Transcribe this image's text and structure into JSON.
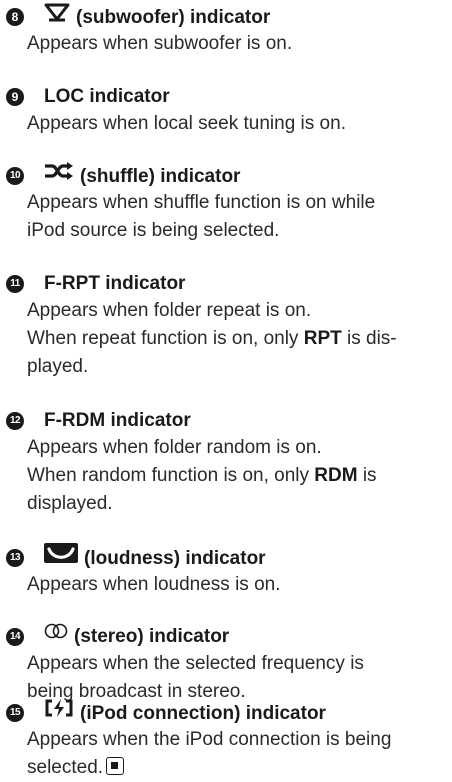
{
  "entries": [
    {
      "number": "8",
      "icon": "subwoofer-icon",
      "title": "(subwoofer) indicator",
      "lines": [
        "Appears when subwoofer is on."
      ]
    },
    {
      "number": "9",
      "title": "LOC indicator",
      "lines": [
        "Appears when local seek tuning is on."
      ]
    },
    {
      "number": "10",
      "icon": "shuffle-icon",
      "title": "(shuffle) indicator",
      "lines": [
        "Appears when shuffle function is on while",
        "iPod source is being selected."
      ]
    },
    {
      "number": "11",
      "title": "F-RPT indicator",
      "lines": [
        "Appears when folder repeat is on."
      ],
      "line2_pre": "When repeat function is on, only ",
      "line2_bold": "RPT",
      "line2_post": " is dis-",
      "line3": "played."
    },
    {
      "number": "12",
      "title": "F-RDM indicator",
      "lines": [
        "Appears when folder random is on."
      ],
      "line2_pre": "When random function is on, only ",
      "line2_bold": "RDM",
      "line2_post": " is",
      "line3": "displayed."
    },
    {
      "number": "13",
      "icon": "loudness-icon",
      "title": "(loudness) indicator",
      "lines": [
        "Appears when loudness is on."
      ]
    },
    {
      "number": "14",
      "icon": "stereo-icon",
      "title": "(stereo) indicator",
      "lines": [
        "Appears when the selected frequency is",
        "being broadcast in stereo."
      ]
    },
    {
      "number": "15",
      "icon": "ipod-connection-icon",
      "title": "(iPod connection) indicator",
      "lines": [
        "Appears when the iPod connection is being",
        "selected."
      ],
      "end_icon": "end-of-section-icon"
    }
  ]
}
